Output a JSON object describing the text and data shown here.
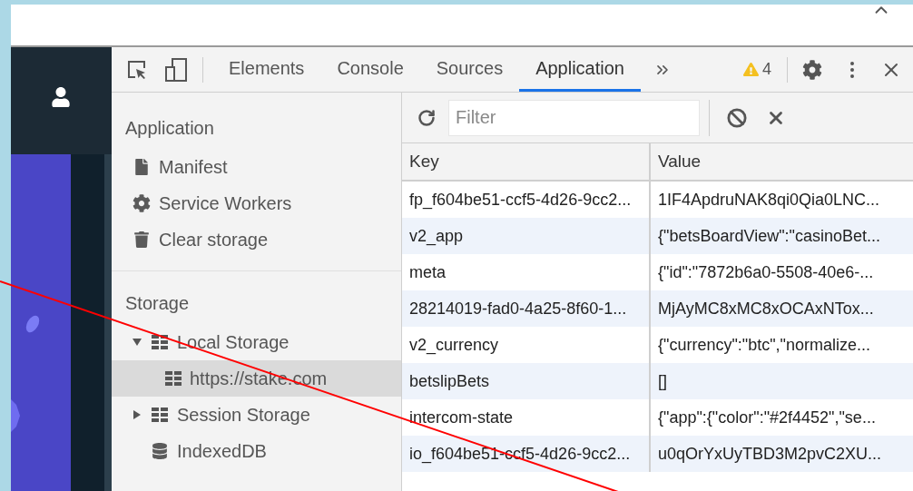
{
  "devtools": {
    "tabs": [
      {
        "label": "Elements",
        "selected": false
      },
      {
        "label": "Console",
        "selected": false
      },
      {
        "label": "Sources",
        "selected": false
      },
      {
        "label": "Application",
        "selected": true
      }
    ],
    "warnings": "4"
  },
  "sidebar": {
    "sections": [
      {
        "title": "Application",
        "items": [
          {
            "label": "Manifest",
            "selected": false
          },
          {
            "label": "Service Workers",
            "selected": false
          },
          {
            "label": "Clear storage",
            "selected": false
          }
        ]
      },
      {
        "title": "Storage",
        "items": [
          {
            "label": "Local Storage",
            "selected": false,
            "expanded": true,
            "children": [
              {
                "label": "https://stake.com",
                "selected": true
              }
            ]
          },
          {
            "label": "Session Storage",
            "selected": false,
            "expanded": false
          },
          {
            "label": "IndexedDB",
            "selected": false
          }
        ]
      }
    ]
  },
  "filter": {
    "placeholder": "Filter"
  },
  "table": {
    "columns": [
      "Key",
      "Value"
    ],
    "rows": [
      {
        "key": "fp_f604be51-ccf5-4d26-9cc2...",
        "value": "1IF4ApdruNAK8qi0Qia0LNC..."
      },
      {
        "key": "v2_app",
        "value": "{\"betsBoardView\":\"casinoBet..."
      },
      {
        "key": "meta",
        "value": "{\"id\":\"7872b6a0-5508-40e6-..."
      },
      {
        "key": "28214019-fad0-4a25-8f60-1...",
        "value": "MjAyMC8xMC8xOCAxNTox..."
      },
      {
        "key": "v2_currency",
        "value": "{\"currency\":\"btc\",\"normalize..."
      },
      {
        "key": "betslipBets",
        "value": "[]"
      },
      {
        "key": "intercom-state",
        "value": "{\"app\":{\"color\":\"#2f4452\",\"se..."
      },
      {
        "key": "io_f604be51-ccf5-4d26-9cc2...",
        "value": "u0qOrYxUyTBD3M2pvC2XU..."
      }
    ]
  }
}
